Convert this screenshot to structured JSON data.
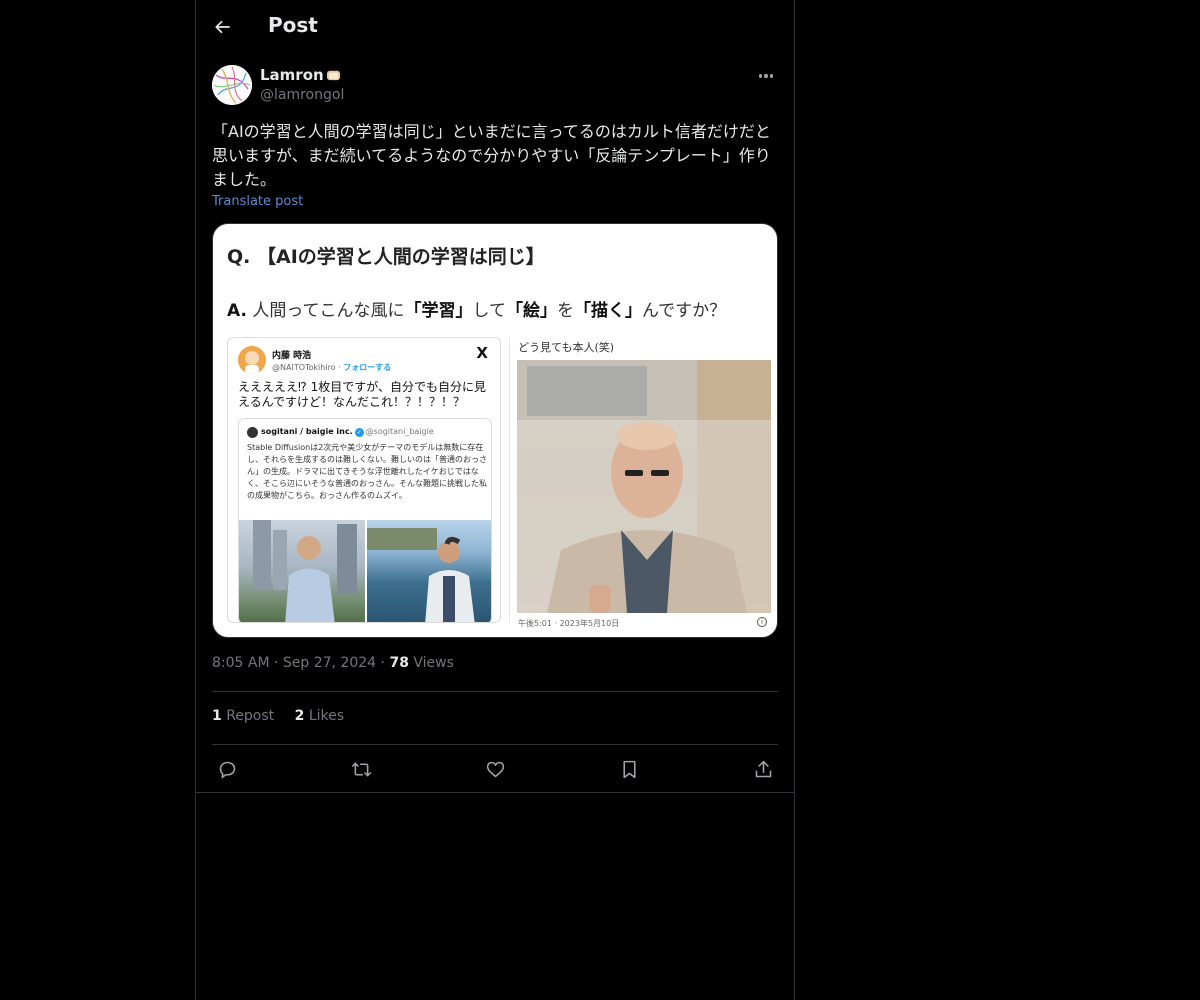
{
  "header": {
    "title": "Post",
    "back_icon": "arrow-left-icon"
  },
  "author": {
    "display_name": "Lamron",
    "emoji": "bread-icon",
    "handle": "@lamrongol",
    "more_icon": "more-icon"
  },
  "post": {
    "text": "「AIの学習と人間の学習は同じ」といまだに言ってるのはカルト信者だけだと思いますが、まだ続いてるようなので分かりやすい「反論テンプレート」作りました。",
    "translate_label": "Translate post"
  },
  "media": {
    "question": "Q. 【AIの学習と人間の学習は同じ】",
    "answer_parts": [
      "A.",
      " 人間ってこんな風に",
      "「学習」",
      "して",
      "「絵」",
      "を",
      "「描く」",
      "んですか？"
    ],
    "embedded_tweet": {
      "name": "内藤 時浩",
      "handle": "@NAITOTokihiro",
      "follow": "フォローする",
      "x_logo": "X",
      "text": "えええええ⁉ 1枚目ですが、自分でも自分に見えるんですけど！なんだこれ！？！？！？",
      "quote": {
        "name": "sogitani / baigie inc.",
        "handle": "@sogitani_baigie",
        "text": "Stable Diffusionは2次元や美少女がテーマのモデルは無数に存在し、それらを生成するのは難しくない。難しいのは「普通のおっさん」の生成。ドラマに出てきそうな浮世離れしたイケおじではなく、そこら辺にいそうな普通のおっさん。そんな難題に挑戦した私の成果物がこちら。おっさん作るのムズイ。"
      }
    },
    "caption": "どう見ても本人(笑)",
    "timestamp": "午後5:01 · 2023年5月10日"
  },
  "meta": {
    "time": "8:05 AM",
    "date": "Sep 27, 2024",
    "views_count": "78",
    "views_label": "Views"
  },
  "stats": {
    "reposts_count": "1",
    "reposts_label": "Repost",
    "likes_count": "2",
    "likes_label": "Likes"
  },
  "actions": {
    "reply_icon": "reply-icon",
    "repost_icon": "repost-icon",
    "like_icon": "heart-icon",
    "bookmark_icon": "bookmark-icon",
    "share_icon": "share-icon"
  },
  "colors": {
    "background": "#000000",
    "text": "#e7e9ea",
    "muted": "#71767b",
    "link": "#5b8bd1",
    "border": "#2f3336"
  }
}
